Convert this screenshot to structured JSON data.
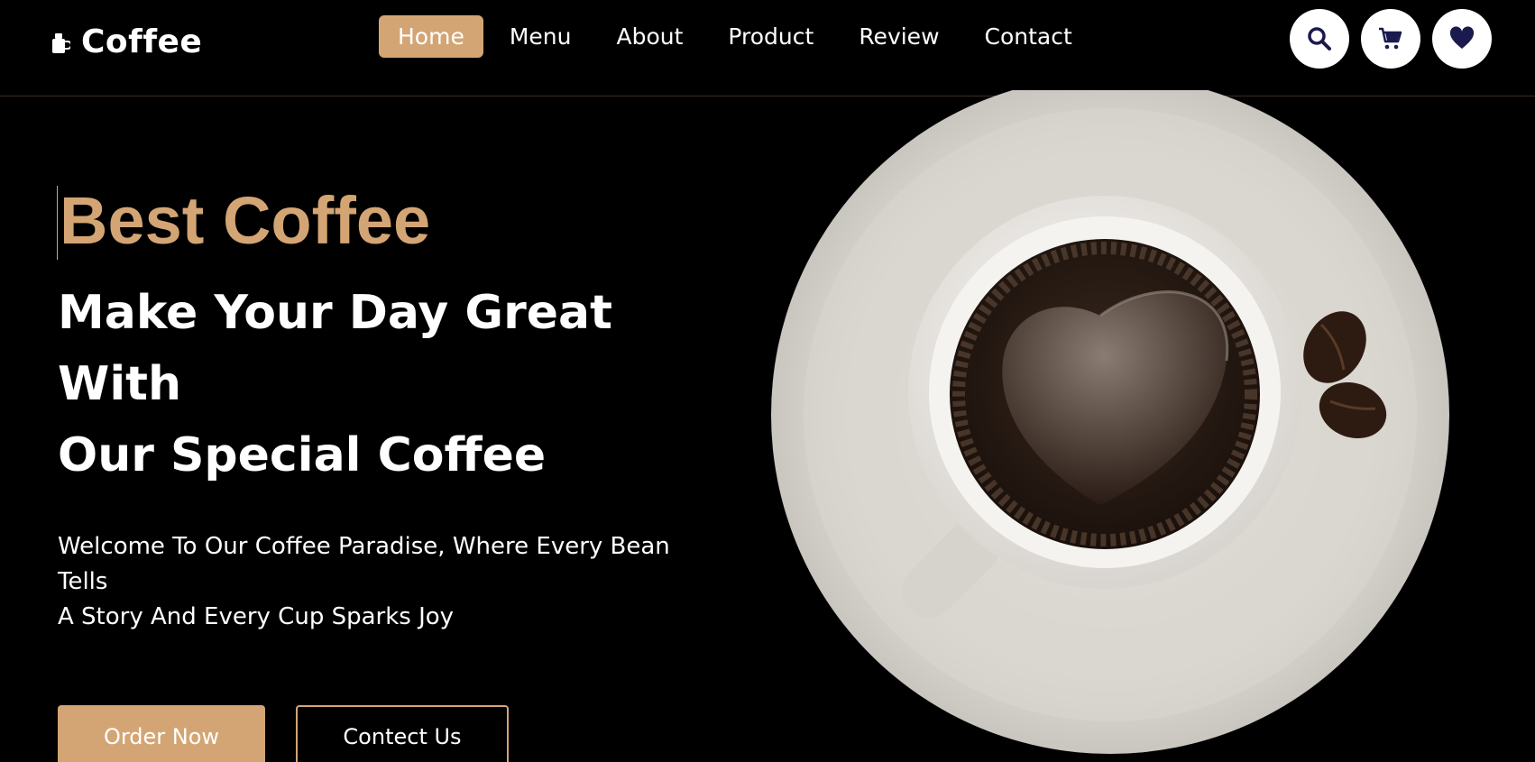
{
  "brand": {
    "name": "Coffee"
  },
  "nav": {
    "items": [
      {
        "label": "Home",
        "active": true
      },
      {
        "label": "Menu",
        "active": false
      },
      {
        "label": "About",
        "active": false
      },
      {
        "label": "Product",
        "active": false
      },
      {
        "label": "Review",
        "active": false
      },
      {
        "label": "Contact",
        "active": false
      }
    ]
  },
  "header_icons": [
    "search-icon",
    "cart-icon",
    "heart-icon"
  ],
  "hero": {
    "accent_title": "Best Coffee",
    "headline_line1": "Make Your Day Great With",
    "headline_line2": "Our Special Coffee",
    "description_line1": "Welcome To Our Coffee Paradise, Where Every Bean Tells",
    "description_line2": "A Story And Every Cup Sparks Joy",
    "primary_button": "Order Now",
    "secondary_button": "Contect Us"
  },
  "colors": {
    "accent": "#d4a574",
    "background": "#000000",
    "icon_navy": "#1a1a4e"
  }
}
